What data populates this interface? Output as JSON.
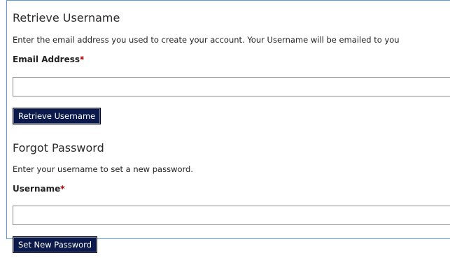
{
  "retrieve": {
    "title": "Retrieve Username",
    "description": "Enter the email address you used to create your account. Your Username will be emailed to you",
    "field_label": "Email Address",
    "required_mark": "*",
    "field_value": "",
    "button_label": "Retrieve Username"
  },
  "forgot": {
    "title": "Forgot Password",
    "description": "Enter your username to set a new password.",
    "field_label": "Username",
    "required_mark": "*",
    "field_value": "",
    "button_label": "Set New Password"
  },
  "colors": {
    "button_bg": "#0b1a4a",
    "required": "#b30000",
    "frame_border": "#5b9bd5"
  }
}
